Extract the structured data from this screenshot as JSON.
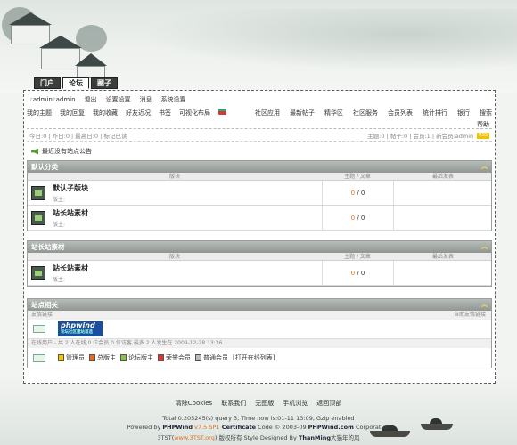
{
  "top_tabs": [
    "门户",
    "论坛",
    "圈子"
  ],
  "userbar": {
    "user1": "admin",
    "user2": "admin",
    "items": [
      "退出",
      "设置设置",
      "消息",
      "系统设置"
    ]
  },
  "menu": {
    "left": [
      "我的主题",
      "我的回复",
      "我的收藏",
      "好友近况",
      "书签",
      "可视化布局"
    ],
    "right": [
      "社区应用",
      "最新帖子",
      "精华区",
      "社区服务",
      "会员列表",
      "统计排行",
      "银行",
      "搜索"
    ],
    "help": "帮助"
  },
  "stats": {
    "left": "今日:0 | 昨日:0 | 最高日:0 | 标记已读",
    "right": "主题:0 | 帖子:0 | 会员:1 | 新会员:admin"
  },
  "notice": "最近没有站点公告",
  "columns": {
    "forum": "版块",
    "topics": "主题 / 文章",
    "last": "最后发表"
  },
  "sections": [
    {
      "title": "默认分类",
      "forums": [
        {
          "name": "默认子版块",
          "mod": "版主:",
          "count_a": "0",
          "count_b": "0"
        },
        {
          "name": "站长站素材",
          "mod": "版主:",
          "count_a": "0",
          "count_b": "0"
        }
      ]
    },
    {
      "title": "站长站素材",
      "forums": [
        {
          "name": "站长站素材",
          "mod": "版主:",
          "count_a": "0",
          "count_b": "0"
        }
      ]
    }
  ],
  "site_related": {
    "title": "站点相关",
    "links_label": "友情链接",
    "auto_links": "自助友情链接",
    "phpwind_text": "phpwind",
    "phpwind_sub": "论坛社区建站首选",
    "online_label": "在线用户 - 共 2 人在线,0 位会员,0 位访客,最多 2 人发生在 2009-12-28 13:36",
    "legend": [
      "管理员",
      "总版主",
      "论坛版主",
      "荣誉会员",
      "普通会员"
    ],
    "open_list": "[打开在线列表]"
  },
  "footer": {
    "links": [
      "清除Cookies",
      "联系我们",
      "无图版",
      "手机浏览",
      "返回顶部"
    ],
    "line1": "Total 0.205245(s) query 3, Time now is:01-11 13:09, Gzip enabled",
    "line2_a": "Powered by ",
    "line2_b": "PHPWind",
    "line2_c": " v7.5 SP1",
    "line2_d": " Certificate",
    "line2_e": " Code © 2003-09 ",
    "line2_f": "PHPWind.com",
    "line2_g": " Corporation",
    "line3_a": "3TST(",
    "line3_b": "www.3TST.org",
    "line3_c": ") 版权所有  Style Designed By ",
    "line3_d": "ThanMing",
    "line3_e": "大猫年的风"
  },
  "colors": {
    "accent": "#e07020",
    "header_bg": "#8f9692",
    "badge": "#f2c200",
    "phpwind": "#1a4fa0"
  }
}
